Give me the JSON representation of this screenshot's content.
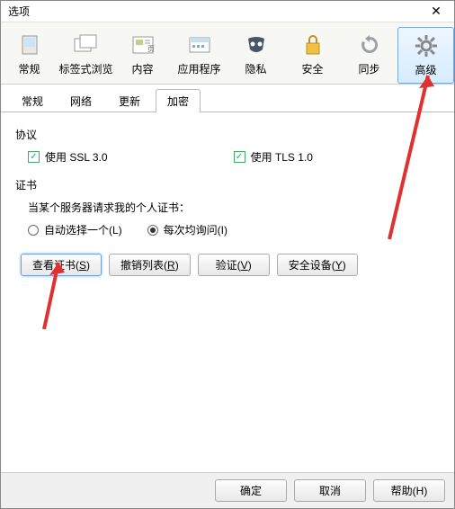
{
  "window": {
    "title": "选项"
  },
  "toolbar": {
    "items": [
      {
        "label": "常规"
      },
      {
        "label": "标签式浏览"
      },
      {
        "label": "内容"
      },
      {
        "label": "应用程序"
      },
      {
        "label": "隐私"
      },
      {
        "label": "安全"
      },
      {
        "label": "同步"
      },
      {
        "label": "高级"
      }
    ],
    "active_index": 7
  },
  "tabs": {
    "items": [
      "常规",
      "网络",
      "更新",
      "加密"
    ],
    "active_index": 3
  },
  "protocol": {
    "title": "协议",
    "ssl_label": "使用 SSL 3.0",
    "ssl_acc": "3",
    "tls_label": "使用 TLS 1.0",
    "tls_acc": "1",
    "ssl_checked": true,
    "tls_checked": true
  },
  "cert": {
    "title": "证书",
    "desc": "当某个服务器请求我的个人证书：",
    "radio_auto": "自动选择一个(L)",
    "radio_ask": "每次均询问(I)",
    "selected": "ask",
    "buttons": {
      "view": {
        "text": "查看证书(",
        "acc": "S",
        "tail": ")"
      },
      "revoke": {
        "text": "撤销列表(",
        "acc": "R",
        "tail": ")"
      },
      "verify": {
        "text": "验证(",
        "acc": "V",
        "tail": ")"
      },
      "device": {
        "text": "安全设备(",
        "acc": "Y",
        "tail": ")"
      }
    }
  },
  "footer": {
    "ok": "确定",
    "cancel": "取消",
    "help": "帮助(H)"
  }
}
